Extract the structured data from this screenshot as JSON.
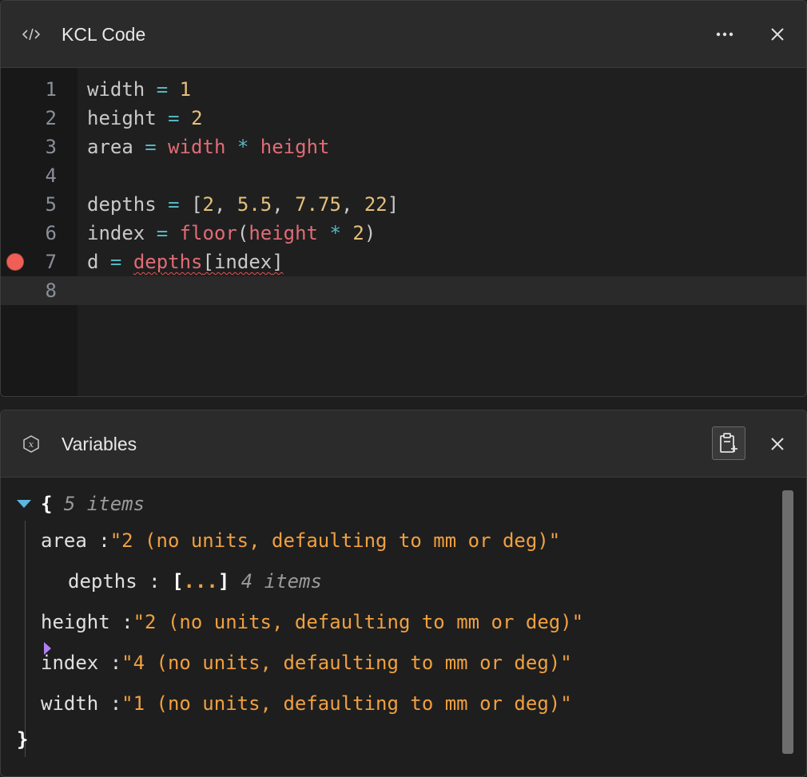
{
  "code_panel": {
    "title": "KCL Code",
    "icon": "code-icon",
    "lines": [
      {
        "num": "1",
        "tokens": [
          {
            "t": "width",
            "c": "var"
          },
          {
            "t": " = ",
            "c": "op"
          },
          {
            "t": "1",
            "c": "num"
          }
        ]
      },
      {
        "num": "2",
        "tokens": [
          {
            "t": "height",
            "c": "var"
          },
          {
            "t": " = ",
            "c": "op"
          },
          {
            "t": "2",
            "c": "num"
          }
        ]
      },
      {
        "num": "3",
        "tokens": [
          {
            "t": "area",
            "c": "var"
          },
          {
            "t": " = ",
            "c": "op"
          },
          {
            "t": "width",
            "c": "ref"
          },
          {
            "t": " * ",
            "c": "op"
          },
          {
            "t": "height",
            "c": "ref"
          }
        ]
      },
      {
        "num": "4",
        "tokens": []
      },
      {
        "num": "5",
        "tokens": [
          {
            "t": "depths",
            "c": "var"
          },
          {
            "t": " = ",
            "c": "op"
          },
          {
            "t": "[",
            "c": "punc"
          },
          {
            "t": "2",
            "c": "num"
          },
          {
            "t": ", ",
            "c": "punc"
          },
          {
            "t": "5.5",
            "c": "num"
          },
          {
            "t": ", ",
            "c": "punc"
          },
          {
            "t": "7.75",
            "c": "num"
          },
          {
            "t": ", ",
            "c": "punc"
          },
          {
            "t": "22",
            "c": "num"
          },
          {
            "t": "]",
            "c": "punc"
          }
        ]
      },
      {
        "num": "6",
        "tokens": [
          {
            "t": "index",
            "c": "var"
          },
          {
            "t": " = ",
            "c": "op"
          },
          {
            "t": "floor",
            "c": "ref"
          },
          {
            "t": "(",
            "c": "punc"
          },
          {
            "t": "height",
            "c": "ref"
          },
          {
            "t": " * ",
            "c": "op"
          },
          {
            "t": "2",
            "c": "num"
          },
          {
            "t": ")",
            "c": "punc"
          }
        ]
      },
      {
        "num": "7",
        "breakpoint": true,
        "tokens": [
          {
            "t": "d",
            "c": "var"
          },
          {
            "t": " = ",
            "c": "op"
          },
          {
            "t": "depths",
            "c": "ref",
            "sq": true
          },
          {
            "t": "[",
            "c": "punc",
            "sq": true
          },
          {
            "t": "index",
            "c": "var",
            "sq": true
          },
          {
            "t": "]",
            "c": "punc",
            "sq": true
          }
        ]
      },
      {
        "num": "8",
        "active": true,
        "tokens": []
      }
    ]
  },
  "variables_panel": {
    "title": "Variables",
    "icon": "variable-icon",
    "root_open": "{",
    "root_close": "}",
    "root_count": "5 items",
    "items": [
      {
        "key": "area",
        "value": "\"2 (no units, defaulting to mm or deg)\""
      },
      {
        "key": "depths",
        "collapsed": true,
        "value": "[...]",
        "count": "4 items"
      },
      {
        "key": "height",
        "value": "\"2 (no units, defaulting to mm or deg)\""
      },
      {
        "key": "index",
        "value": "\"4 (no units, defaulting to mm or deg)\""
      },
      {
        "key": "width",
        "value": "\"1 (no units, defaulting to mm or deg)\""
      }
    ]
  },
  "colors": {
    "accent_breakpoint": "#ef5f55",
    "string_value": "#f0a040",
    "expand_arrow_open": "#5bb8e0",
    "expand_arrow_closed": "#b07ff0"
  }
}
